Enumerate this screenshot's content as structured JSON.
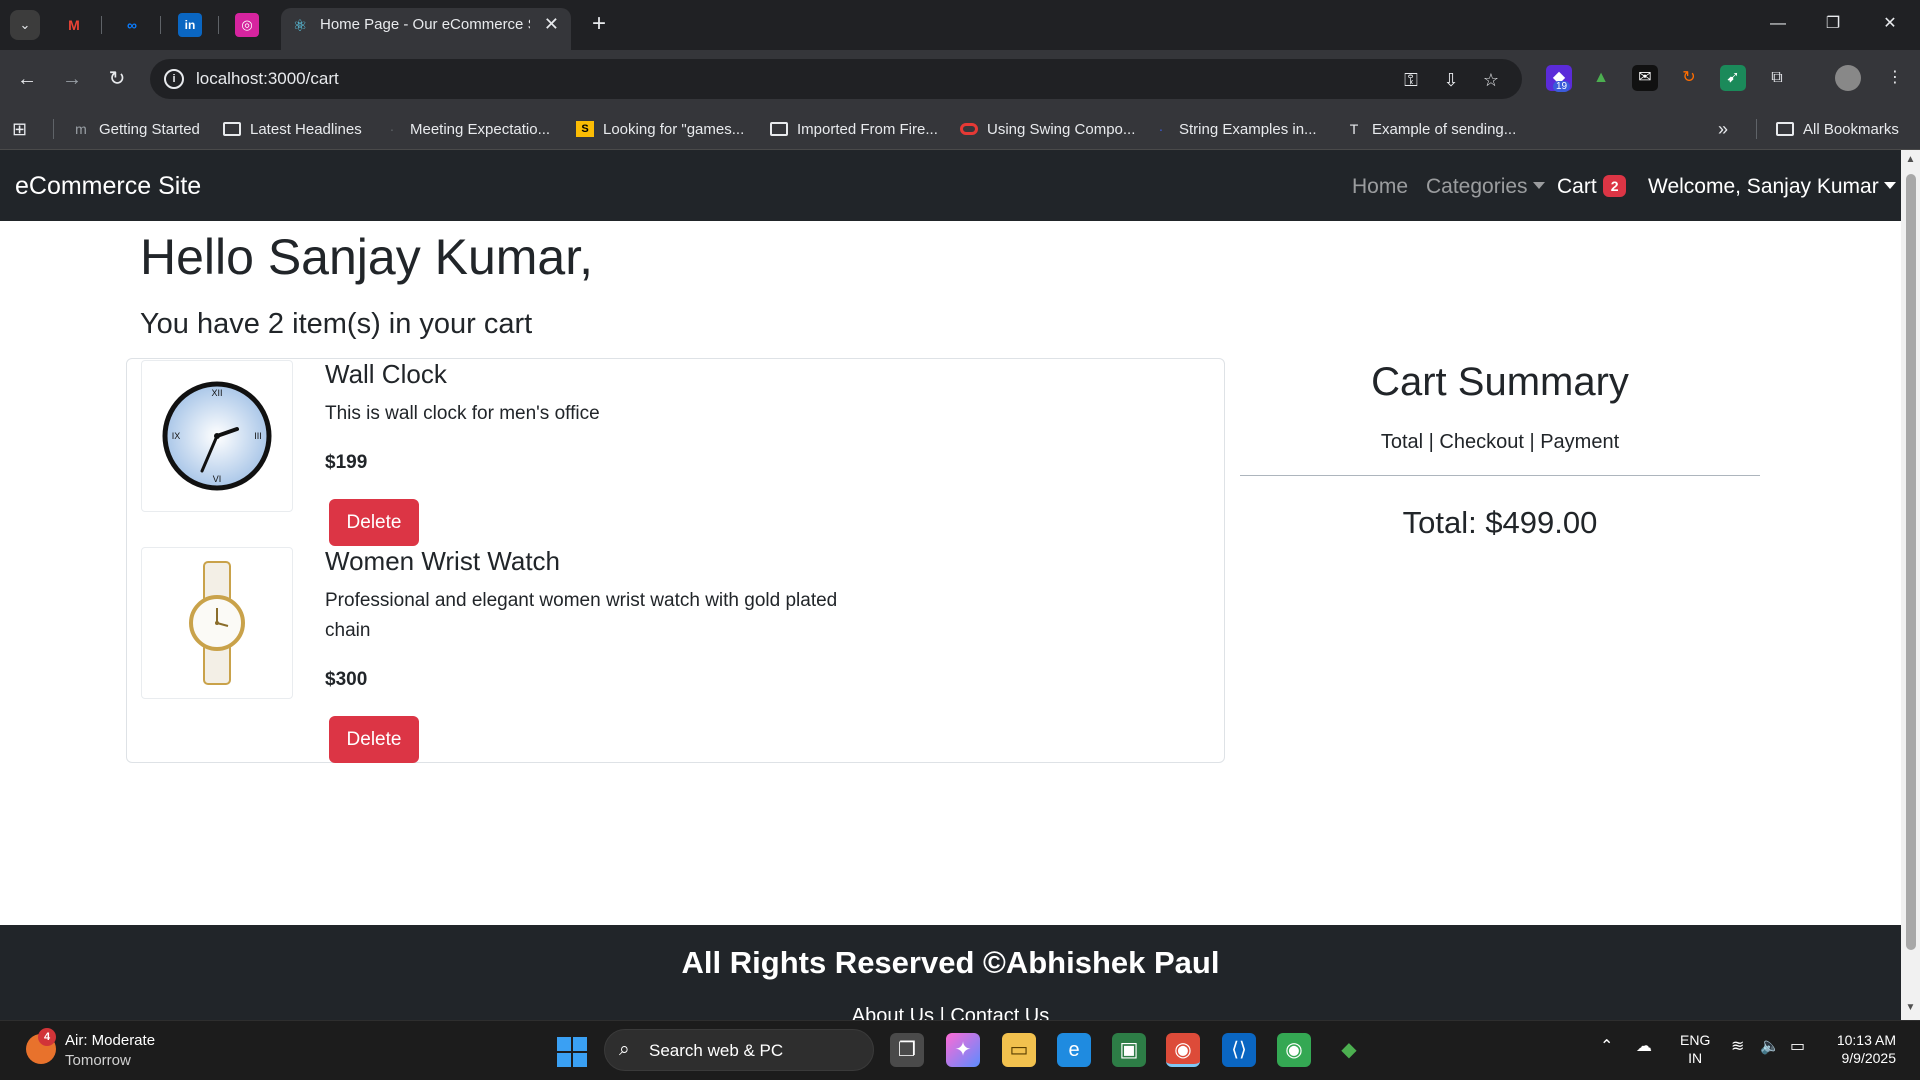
{
  "browser": {
    "active_tab_title": "Home Page - Our eCommerce Site",
    "url": "localhost:3000/cart",
    "bookmarks": [
      {
        "label": "Getting Started",
        "icon": "m-logo-icon"
      },
      {
        "label": "Latest Headlines",
        "icon": "folder-icon"
      },
      {
        "label": "Meeting Expectatio...",
        "icon": "site-icon"
      },
      {
        "label": "Looking for \"games...",
        "icon": "sql-icon"
      },
      {
        "label": "Imported From Fire...",
        "icon": "folder-icon"
      },
      {
        "label": "Using Swing Compo...",
        "icon": "oracle-icon"
      },
      {
        "label": "String Examples in...",
        "icon": "site-icon"
      },
      {
        "label": "Example of sending...",
        "icon": "t-icon"
      }
    ],
    "all_bookmarks": "All Bookmarks",
    "extension_badge": "19"
  },
  "site": {
    "brand": "eCommerce Site",
    "nav": {
      "home": "Home",
      "categories": "Categories",
      "cart": "Cart",
      "cart_count": "2",
      "welcome": "Welcome, Sanjay Kumar"
    },
    "greeting": "Hello Sanjay Kumar,",
    "cart_count_text": "You have 2 item(s) in your cart",
    "items": [
      {
        "name": "Wall Clock",
        "description": "This is wall clock for men's office",
        "price": "$199",
        "delete_label": "Delete"
      },
      {
        "name": "Women Wrist Watch",
        "description": "Professional and elegant women wrist watch with gold plated chain",
        "price": "$300",
        "delete_label": "Delete"
      }
    ],
    "summary": {
      "title": "Cart Summary",
      "subtitle": "Total | Checkout | Payment",
      "total": "Total: $499.00"
    },
    "footer": {
      "text": "All Rights Reserved ©Abhishek Paul",
      "links": "About Us | Contact Us"
    }
  },
  "taskbar": {
    "weather_main": "Air: Moderate",
    "weather_sub": "Tomorrow",
    "weather_badge": "4",
    "search_text": "Search web & PC",
    "lang_1": "ENG",
    "lang_2": "IN",
    "time": "10:13 AM",
    "date": "9/9/2025"
  },
  "colors": {
    "navbar": "#212529",
    "danger": "#dc3545",
    "browser_bg": "#202124"
  }
}
